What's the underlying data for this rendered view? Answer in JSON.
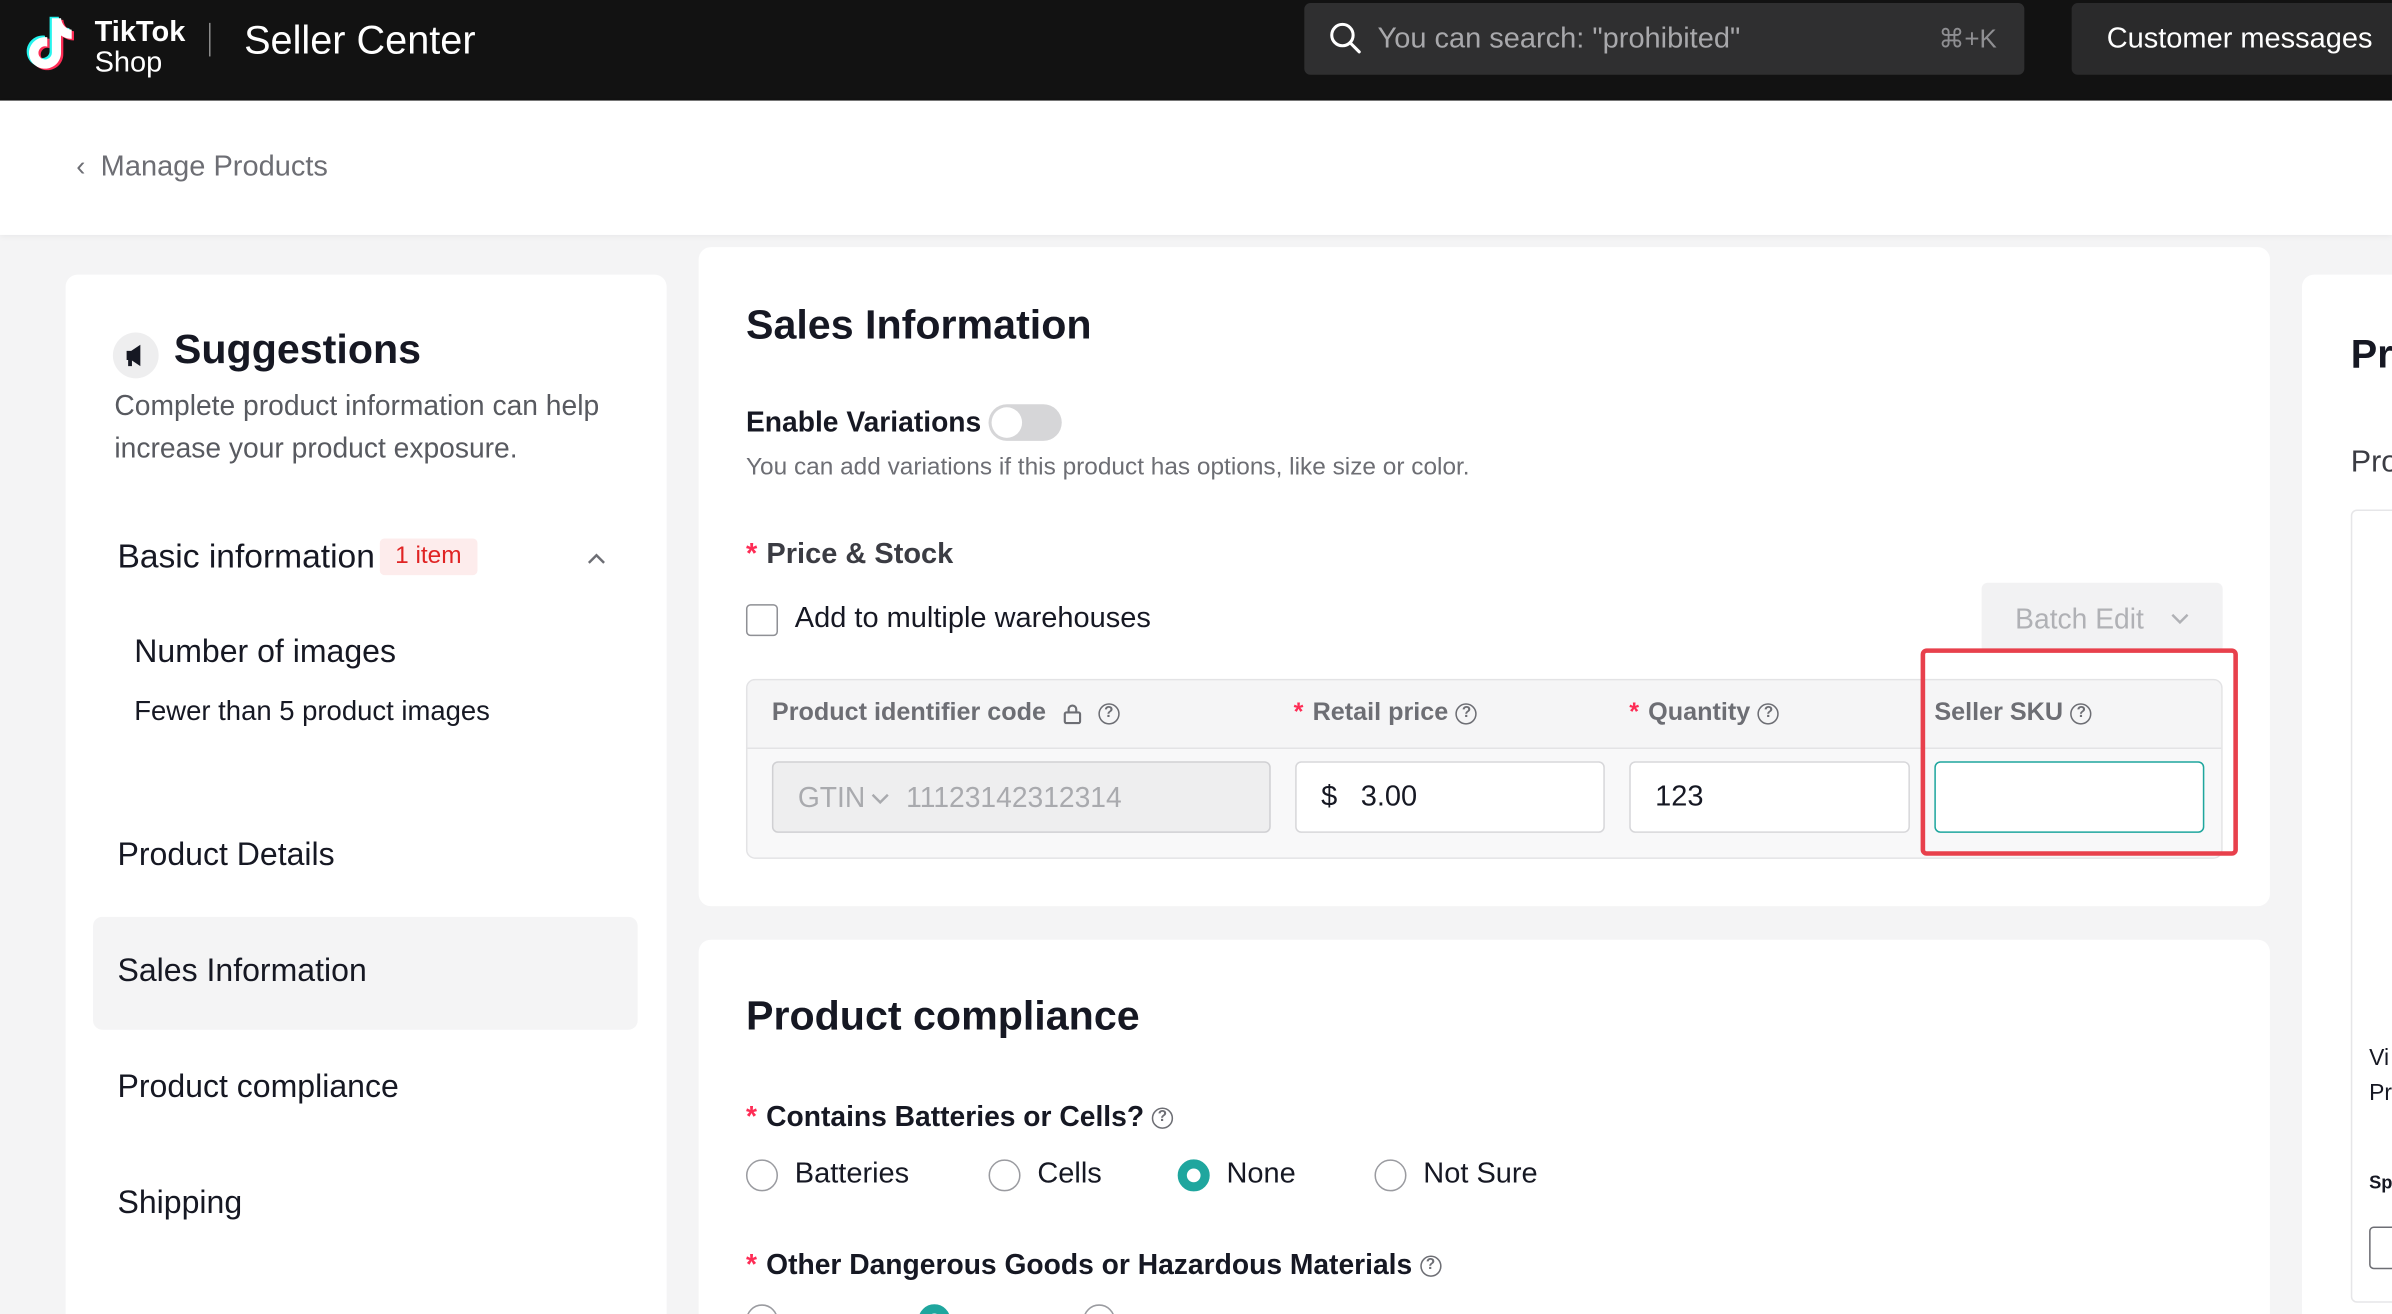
{
  "topbar": {
    "logo_line1": "TikTok",
    "logo_line2": "Shop",
    "title": "Seller Center",
    "search_placeholder": "You can search: \"prohibited\"",
    "search_shortcut": "⌘+K",
    "customer_messages": "Customer messages"
  },
  "breadcrumb": {
    "back_label": "Manage Products"
  },
  "sidebar": {
    "title": "Suggestions",
    "description": "Complete product information can help increase your product exposure.",
    "basic_info": {
      "label": "Basic information",
      "badge": "1 item",
      "sub_title": "Number of images",
      "sub_desc": "Fewer than 5 product images"
    },
    "nav": [
      {
        "label": "Product Details"
      },
      {
        "label": "Sales Information"
      },
      {
        "label": "Product compliance"
      },
      {
        "label": "Shipping"
      }
    ],
    "active_nav": "Sales Information"
  },
  "sales": {
    "title": "Sales Information",
    "enable_variations_label": "Enable Variations",
    "enable_variations_on": false,
    "variations_help": "You can add variations if this product has options, like size or color.",
    "price_stock_label": "Price & Stock",
    "warehouses_label": "Add to multiple warehouses",
    "batch_edit_label": "Batch Edit",
    "table": {
      "headers": {
        "identifier": "Product identifier code",
        "retail_price": "Retail price",
        "quantity": "Quantity",
        "seller_sku": "Seller SKU"
      },
      "row": {
        "identifier_type": "GTIN",
        "identifier_value": "11123142312314",
        "currency": "$",
        "price": "3.00",
        "quantity": "123",
        "seller_sku": ""
      }
    }
  },
  "compliance": {
    "title": "Product compliance",
    "q1": {
      "label": "Contains Batteries or Cells?",
      "options": [
        "Batteries",
        "Cells",
        "None",
        "Not Sure"
      ],
      "selected": "None"
    },
    "q2": {
      "label": "Other Dangerous Goods or Hazardous Materials"
    }
  },
  "right_panel": {
    "title_fragment": "Pr",
    "sub_fragment": "Pro",
    "line1": "Vi",
    "line2": "Pr",
    "line3": "Sp"
  },
  "colors": {
    "accent": "#1fa69e",
    "required": "#fe2c55",
    "highlight": "#e8404c",
    "topbar": "#121212"
  }
}
